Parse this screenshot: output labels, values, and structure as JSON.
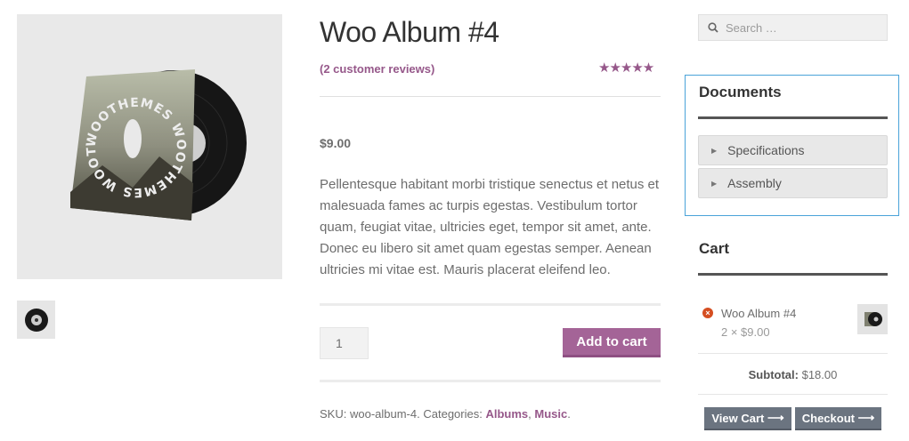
{
  "product": {
    "title": "Woo Album #4",
    "reviews_link": "(2 customer reviews)",
    "rating_stars": 5,
    "rating_glyphs": "★★★★★",
    "price": "$9.00",
    "description": "Pellentesque habitant morbi tristique senectus et netus et malesuada fames ac turpis egestas. Vestibulum tortor quam, feugiat vitae, ultricies eget, tempor sit amet, ante. Donec eu libero sit amet quam egestas semper. Aenean ultricies mi vitae est. Mauris placerat eleifend leo.",
    "quantity": "1",
    "add_to_cart_label": "Add to cart",
    "sku_label": "SKU:",
    "sku_value": "woo-album-4.",
    "categories_label": "Categories:",
    "categories": [
      "Albums",
      "Music"
    ],
    "cat_separator": ",",
    "cat_end": ".",
    "album_art_text": "WOOTHEMES WOOTHEMES WOOTHEMES"
  },
  "sidebar": {
    "search_placeholder": "Search …",
    "documents_title": "Documents",
    "documents": [
      "Specifications",
      "Assembly"
    ],
    "cart_title": "Cart",
    "cart_item_name": "Woo Album #4",
    "cart_item_qty": "2 × $9.00",
    "remove_glyph": "×",
    "subtotal_label": "Subtotal:",
    "subtotal_value": "$18.00",
    "view_cart_label": "View Cart",
    "checkout_label": "Checkout",
    "arrow": "⟶"
  },
  "colors": {
    "accent": "#96588a",
    "button": "#a46497",
    "dark_button": "#6b7480",
    "highlight_border": "#4aa3d9"
  }
}
